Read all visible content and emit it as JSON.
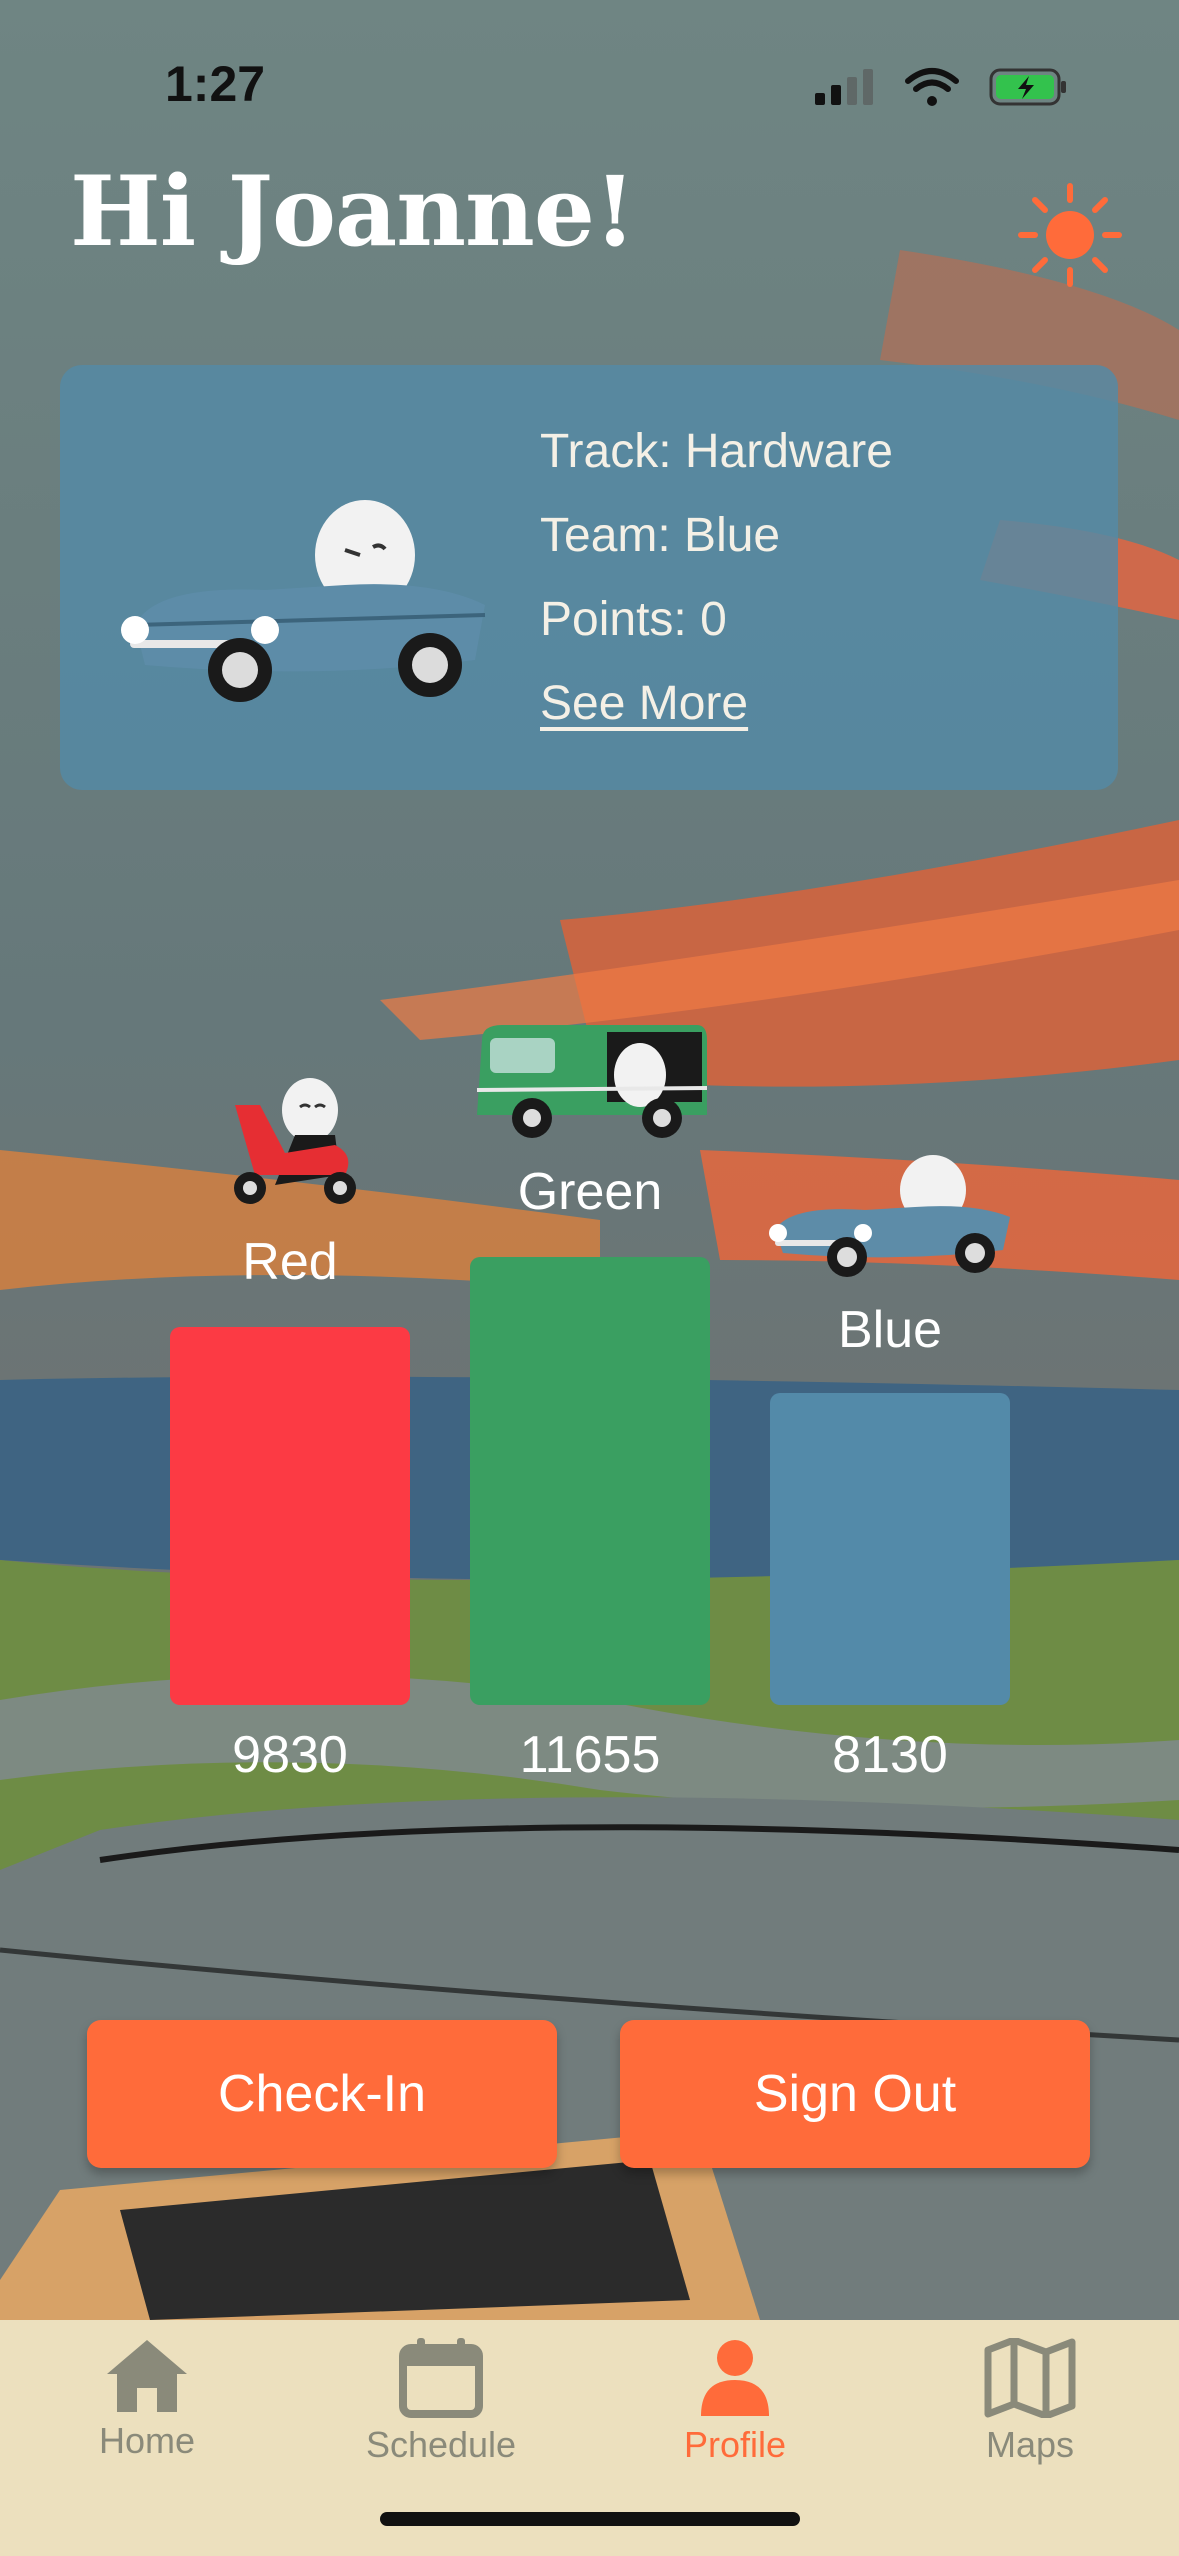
{
  "status_bar": {
    "time": "1:27"
  },
  "header": {
    "greeting": "Hi Joanne!"
  },
  "profile_card": {
    "track": "Track: Hardware",
    "team": "Team: Blue",
    "points": "Points: 0",
    "see_more": "See More"
  },
  "teams": [
    {
      "label": "Red",
      "score": "9830",
      "color": "#fc3a44"
    },
    {
      "label": "Green",
      "score": "11655",
      "color": "#3a9f61"
    },
    {
      "label": "Blue",
      "score": "8130",
      "color": "#538aa9"
    }
  ],
  "actions": {
    "check_in": "Check-In",
    "sign_out": "Sign Out"
  },
  "tabbar": {
    "tabs": [
      {
        "label": "Home",
        "icon": "house-icon",
        "active": false
      },
      {
        "label": "Schedule",
        "icon": "calendar-icon",
        "active": false
      },
      {
        "label": "Profile",
        "icon": "person-icon",
        "active": true
      },
      {
        "label": "Maps",
        "icon": "map-icon",
        "active": false
      }
    ]
  },
  "colors": {
    "accent": "#ff6b3a",
    "card": "#5589a5",
    "tabbar_bg": "#ece0be",
    "tab_inactive": "#8a8a7a"
  }
}
